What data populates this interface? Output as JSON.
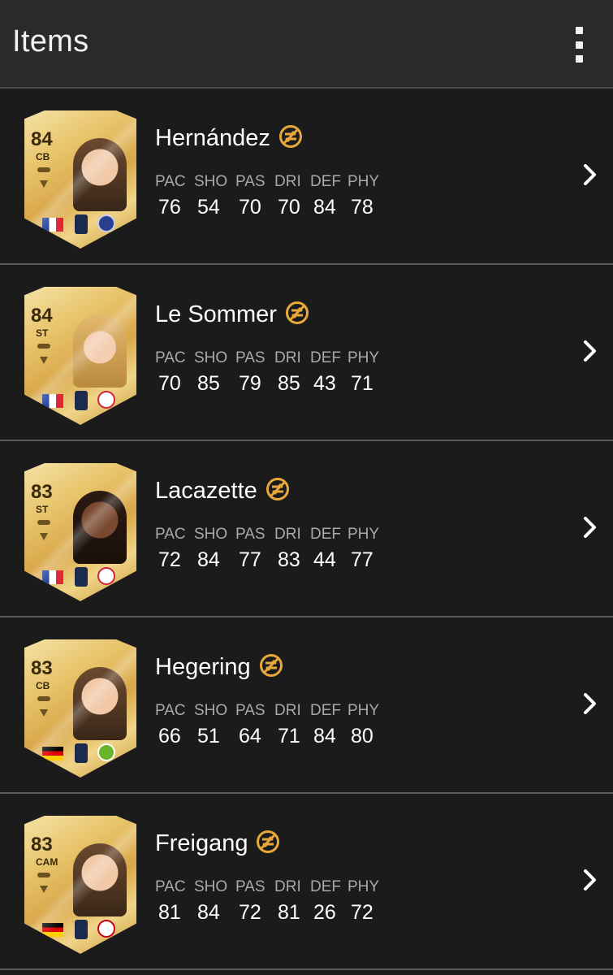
{
  "appbar": {
    "title": "Items",
    "menu_icon": "more-vert-icon"
  },
  "stat_labels": [
    "PAC",
    "SHO",
    "PAS",
    "DRI",
    "DEF",
    "PHY"
  ],
  "colors": {
    "accent_gold": "#e8a93a",
    "background": "#1b1b1b",
    "appbar": "#2a2a2a"
  },
  "items": [
    {
      "name": "Hernández",
      "rating": "84",
      "position": "CB",
      "nation_flag": "france-flag",
      "club": "psg-badge",
      "league": "ligue-1-badge",
      "stats": [
        "76",
        "54",
        "70",
        "70",
        "84",
        "78"
      ]
    },
    {
      "name": "Le Sommer",
      "rating": "84",
      "position": "ST",
      "nation_flag": "france-flag",
      "club": "lyon-badge",
      "league": "d1-arkema-badge",
      "stats": [
        "70",
        "85",
        "79",
        "85",
        "43",
        "71"
      ]
    },
    {
      "name": "Lacazette",
      "rating": "83",
      "position": "ST",
      "nation_flag": "france-flag",
      "club": "lyon-badge",
      "league": "ligue-1-badge",
      "stats": [
        "72",
        "84",
        "77",
        "83",
        "44",
        "77"
      ]
    },
    {
      "name": "Hegering",
      "rating": "83",
      "position": "CB",
      "nation_flag": "germany-flag",
      "club": "wolfsburg-badge",
      "league": "frauen-bundesliga-badge",
      "stats": [
        "66",
        "51",
        "64",
        "71",
        "84",
        "80"
      ]
    },
    {
      "name": "Freigang",
      "rating": "83",
      "position": "CAM",
      "nation_flag": "germany-flag",
      "club": "frankfurt-badge",
      "league": "frauen-bundesliga-badge",
      "stats": [
        "81",
        "84",
        "72",
        "81",
        "26",
        "72"
      ]
    }
  ]
}
